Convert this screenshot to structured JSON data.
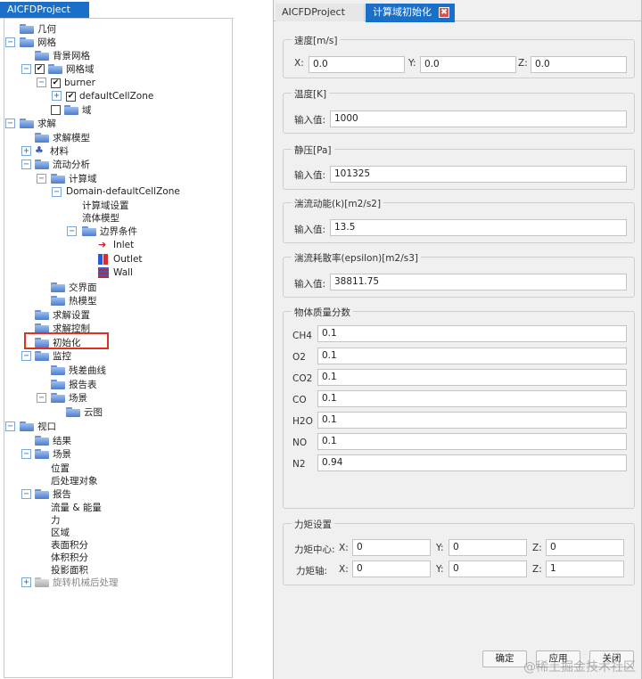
{
  "left": {
    "tab_title": "AICFDProject",
    "tree": {
      "geometry": "几何",
      "mesh": "网格",
      "background_mesh": "背景网格",
      "mesh_domain": "网格域",
      "burner": "burner",
      "default_cell_zone": "defaultCellZone",
      "domain": "域",
      "solve": "求解",
      "solve_model": "求解模型",
      "material": "材料",
      "flow_analysis": "流动分析",
      "compute_domain": "计算域",
      "domain_default": "Domain-defaultCellZone",
      "compute_domain_settings": "计算域设置",
      "fluid_model": "流体模型",
      "boundary_conditions": "边界条件",
      "inlet": "Inlet",
      "outlet": "Outlet",
      "wall": "Wall",
      "interface": "交界面",
      "thermal_model": "热模型",
      "solve_settings": "求解设置",
      "solve_control": "求解控制",
      "initialize": "初始化",
      "monitor": "监控",
      "residual_curve": "残差曲线",
      "report_table": "报告表",
      "scene": "场景",
      "contour": "云图",
      "view": "视口",
      "result": "结果",
      "view_scene": "场景",
      "position": "位置",
      "postprocess_object": "后处理对象",
      "report": "报告",
      "flux_energy": "流量 & 能量",
      "force": "力",
      "region": "区域",
      "surface_integral": "表面积分",
      "volume_integral": "体积积分",
      "projected_area": "投影面积",
      "turbo_post": "旋转机械后处理"
    }
  },
  "right": {
    "tabs": {
      "project": "AICFDProject",
      "init": "计算域初始化",
      "close_glyph": "✖"
    },
    "velocity": {
      "title": "速度[m/s]",
      "x_label": "X:",
      "x_value": "0.0",
      "y_label": "Y:",
      "y_value": "0.0",
      "z_label": "Z:",
      "z_value": "0.0"
    },
    "temperature": {
      "title": "温度[K]",
      "label": "输入值:",
      "value": "1000"
    },
    "static_pressure": {
      "title": "静压[Pa]",
      "label": "输入值:",
      "value": "101325"
    },
    "tke": {
      "title": "湍流动能(k)[m2/s2]",
      "label": "输入值:",
      "value": "13.5"
    },
    "epsilon": {
      "title": "湍流耗散率(epsilon)[m2/s3]",
      "label": "输入值:",
      "value": "38811.75"
    },
    "species": {
      "title": "物体质量分数",
      "items": [
        {
          "name": "CH4",
          "value": "0.1"
        },
        {
          "name": "O2",
          "value": "0.1"
        },
        {
          "name": "CO2",
          "value": "0.1"
        },
        {
          "name": "CO",
          "value": "0.1"
        },
        {
          "name": "H2O",
          "value": "0.1"
        },
        {
          "name": "NO",
          "value": "0.1"
        },
        {
          "name": "N2",
          "value": "0.94"
        }
      ]
    },
    "moment": {
      "title": "力矩设置",
      "center_label": "力矩中心:",
      "axis_label": "力矩轴:",
      "x": "X:",
      "y": "Y:",
      "z": "Z:",
      "center": {
        "x": "0",
        "y": "0",
        "z": "0"
      },
      "axis": {
        "x": "0",
        "y": "0",
        "z": "1"
      }
    },
    "buttons": {
      "ok": "确定",
      "apply": "应用",
      "close": "关闭"
    },
    "watermark": "@稀土掘金技术社区"
  },
  "colors": {
    "tab_active": "#1a6fc9",
    "highlight": "#e0301e",
    "panel_bg": "#f0f0f0"
  }
}
